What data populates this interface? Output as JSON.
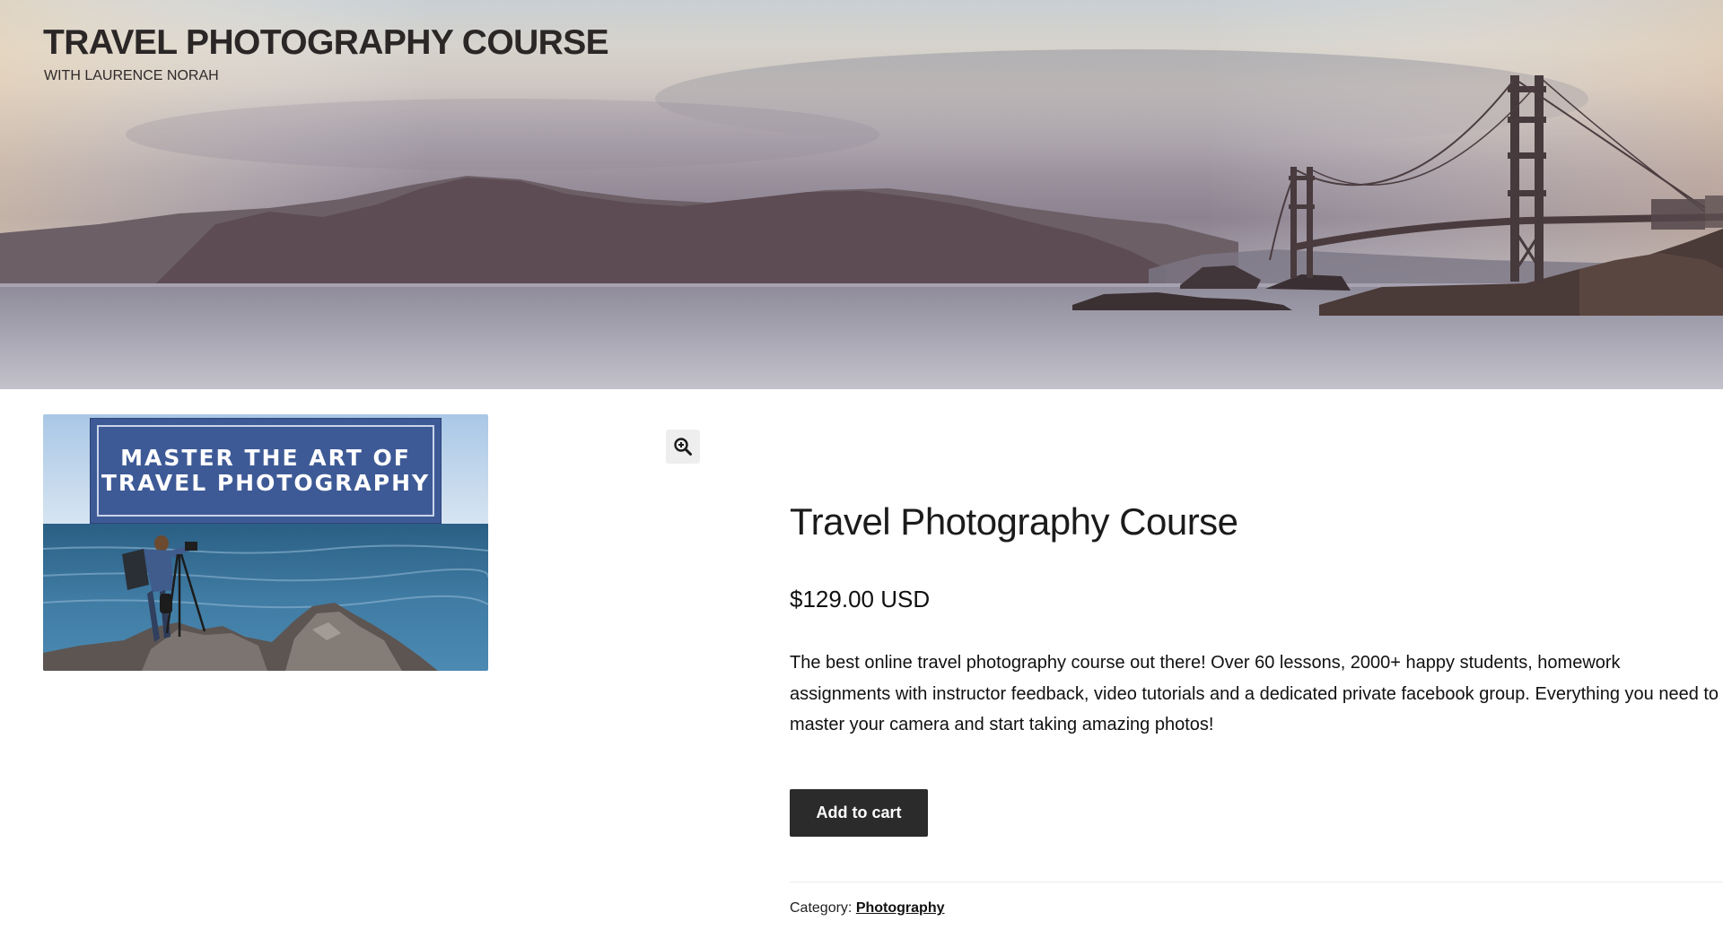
{
  "header": {
    "site_title": "TRAVEL PHOTOGRAPHY COURSE",
    "site_subtitle": "WITH LAURENCE NORAH"
  },
  "product_image": {
    "banner_line1": "MASTER THE ART OF",
    "banner_line2": "TRAVEL PHOTOGRAPHY",
    "zoom_icon": "zoom-in-icon"
  },
  "product": {
    "title": "Travel Photography Course",
    "price": "$129.00 USD",
    "description": "The best online travel photography course out there! Over 60 lessons, 2000+ happy students, homework assignments with instructor feedback, video tutorials and a dedicated private facebook group. Everything you need to master your camera and start taking amazing photos!",
    "add_to_cart_label": "Add to cart",
    "category_label": "Category:",
    "category_value": "Photography"
  },
  "colors": {
    "button_bg": "#2b2b2b",
    "banner_blue": "#3e5a96",
    "title_dark": "#2b2727"
  }
}
